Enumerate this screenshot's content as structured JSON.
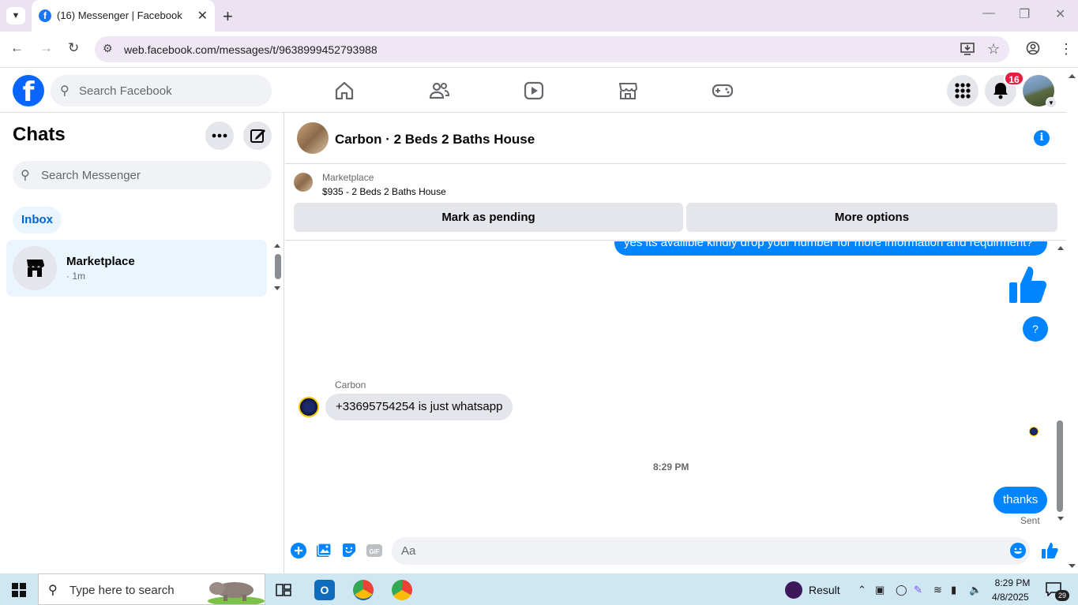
{
  "browser": {
    "tab_title": "(16) Messenger | Facebook",
    "url": "web.facebook.com/messages/t/9638999452793988"
  },
  "facebook": {
    "search_placeholder": "Search Facebook",
    "notification_count": "16"
  },
  "sidebar": {
    "title": "Chats",
    "search_placeholder": "Search Messenger",
    "filter_label": "Inbox",
    "chats": [
      {
        "name": "Marketplace",
        "time": "· 1m"
      }
    ]
  },
  "conversation": {
    "title": "Carbon · 2 Beds 2 Baths House",
    "marketplace_label": "Marketplace",
    "listing_price_title": "$935 - 2 Beds 2 Baths House",
    "mark_pending_label": "Mark as pending",
    "more_options_label": "More options",
    "messages": {
      "outgoing_1": "yes its availible kindly drop your number for more information and requirment?",
      "outgoing_q": "?",
      "sender_name": "Carbon",
      "incoming_1": "+33695754254 is just whatsapp",
      "timestamp": "8:29 PM",
      "outgoing_thanks": "thanks",
      "status": "Sent"
    },
    "composer_placeholder": "Aa"
  },
  "taskbar": {
    "search_text": "Type here to search",
    "widget_text": "Result",
    "time": "8:29 PM",
    "date": "4/8/2025",
    "notification_count": "29"
  },
  "colors": {
    "messenger_blue": "#0084ff",
    "facebook_blue": "#0866ff",
    "badge_red": "#e41e3f"
  }
}
